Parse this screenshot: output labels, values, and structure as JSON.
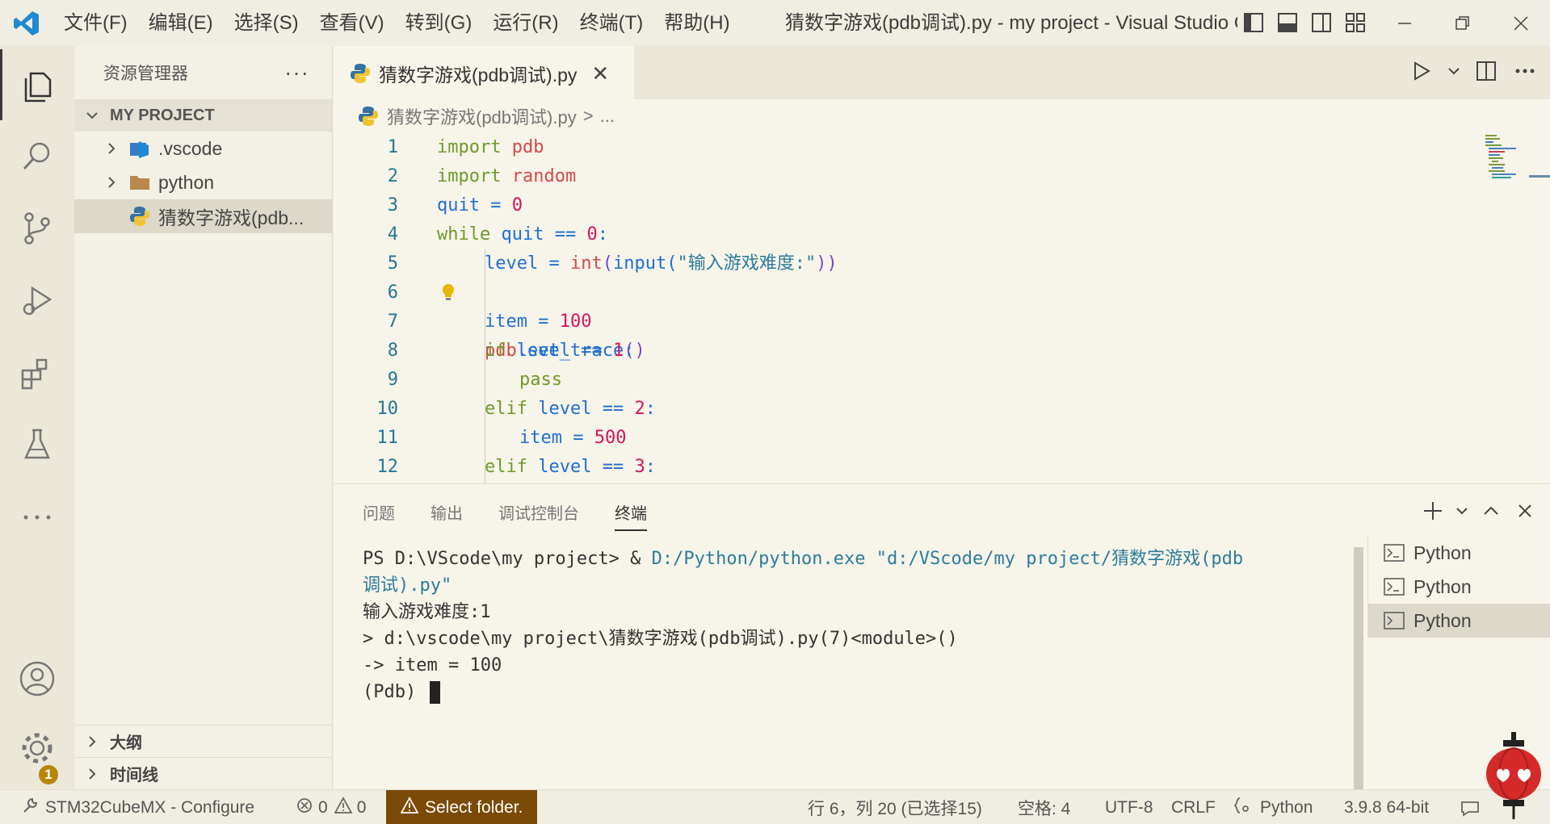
{
  "titlebar": {
    "menu": [
      "文件(F)",
      "编辑(E)",
      "选择(S)",
      "查看(V)",
      "转到(G)",
      "运行(R)",
      "终端(T)",
      "帮助(H)"
    ],
    "title": "猜数字游戏(pdb调试).py - my project - Visual Studio C..."
  },
  "sidebar": {
    "header": "资源管理器",
    "more": "···",
    "section": "MY PROJECT",
    "tree": [
      {
        "label": ".vscode",
        "type": "folder"
      },
      {
        "label": "python",
        "type": "folder"
      },
      {
        "label": "猜数字游戏(pdb...",
        "type": "python-file"
      }
    ],
    "outline": "大纲",
    "timeline": "时间线"
  },
  "activity": {
    "badge": "1"
  },
  "editor": {
    "tab_label": "猜数字游戏(pdb调试).py",
    "tab_close": "✕",
    "breadcrumb_file": "猜数字游戏(pdb调试).py",
    "breadcrumb_sep": ">",
    "breadcrumb_more": "...",
    "line_numbers": [
      "1",
      "2",
      "3",
      "4",
      "5",
      "6",
      "7",
      "8",
      "9",
      "10",
      "11",
      "12"
    ],
    "code": {
      "l1_kw": "import",
      "l1_mod": "pdb",
      "l2_kw": "import",
      "l2_mod": "random",
      "l3_id": "quit",
      "l3_op": " = ",
      "l3_num": "0",
      "l4_kw": "while",
      "l4_id": " quit",
      "l4_op": " == ",
      "l4_num": "0",
      "l4_end": ":",
      "l5_id": "level",
      "l5_op": " = ",
      "l5_fn": "int",
      "l5_p1": "(",
      "l5_fn2": "input",
      "l5_p2": "(",
      "l5_str": "\"输入游戏难度:\"",
      "l5_p3": "))",
      "l6_mod": "pdb",
      "l6_dot": ".",
      "l6_fn": "set_trace",
      "l6_p": "()",
      "l7_id": "item",
      "l7_op": " = ",
      "l7_num": "100",
      "l8_kw": "if",
      "l8_id": " level",
      "l8_op": " == ",
      "l8_num": "1",
      "l8_end": ":",
      "l9_kw": "pass",
      "l10_kw": "elif",
      "l10_id": " level",
      "l10_op": " == ",
      "l10_num": "2",
      "l10_end": ":",
      "l11_id": "item",
      "l11_op": " = ",
      "l11_num": "500",
      "l12_kw": "elif",
      "l12_id": " level",
      "l12_op": " == ",
      "l12_num": "3",
      "l12_end": ":"
    }
  },
  "panel": {
    "tabs": [
      "问题",
      "输出",
      "调试控制台",
      "终端"
    ],
    "active_tab": "终端",
    "terminal": {
      "line1_prompt": "PS D:\\VScode\\my project> & ",
      "line1_exe": "D:/Python/python.exe",
      "line1_str": " \"d:/VScode/my project/猜数字游戏(pdb",
      "line2_str": "调试).py\"",
      "line3": "输入游戏难度:1",
      "line4": "> d:\\vscode\\my project\\猜数字游戏(pdb调试).py(7)<module>()",
      "line5": "-> item = 100",
      "line6": "(Pdb) "
    },
    "terminals": [
      "Python",
      "Python",
      "Python"
    ]
  },
  "statusbar": {
    "configure": "STM32CubeMX - Configure",
    "errors": "0",
    "warnings": "0",
    "select_folder": "Select folder.",
    "position": "行 6，列 20 (已选择15)",
    "spaces": "空格: 4",
    "encoding": "UTF-8",
    "eol": "CRLF",
    "language": "Python",
    "interpreter": "3.9.8 64-bit"
  },
  "colors": {
    "accent_blue": "#1e6fd0",
    "keyword_green": "#6f9a2a",
    "number_pink": "#d6155a",
    "warning_button": "#7a4a06"
  }
}
